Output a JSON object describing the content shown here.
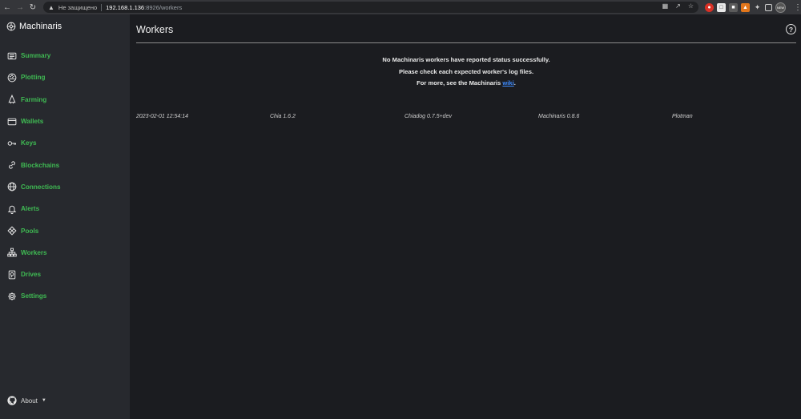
{
  "browser": {
    "security_label": "Не защищено",
    "url_host": "192.168.1.136",
    "url_rest": ":8926/workers",
    "profile_label": "NEW"
  },
  "sidebar": {
    "brand": "Machinaris",
    "items": [
      {
        "label": "Summary",
        "icon": "summary-icon"
      },
      {
        "label": "Plotting",
        "icon": "plotting-icon"
      },
      {
        "label": "Farming",
        "icon": "farming-icon"
      },
      {
        "label": "Wallets",
        "icon": "wallet-icon"
      },
      {
        "label": "Keys",
        "icon": "key-icon"
      },
      {
        "label": "Blockchains",
        "icon": "link-icon"
      },
      {
        "label": "Connections",
        "icon": "globe-icon"
      },
      {
        "label": "Alerts",
        "icon": "bell-icon"
      },
      {
        "label": "Pools",
        "icon": "pools-icon"
      },
      {
        "label": "Workers",
        "icon": "diagram-icon"
      },
      {
        "label": "Drives",
        "icon": "drive-icon"
      },
      {
        "label": "Settings",
        "icon": "gear-icon"
      }
    ],
    "about_label": "About"
  },
  "main": {
    "title": "Workers",
    "notice_line1": "No Machinaris workers have reported status successfully.",
    "notice_line2": "Please check each expected worker's log files.",
    "notice_line3_prefix": "For more, see the Machinaris ",
    "notice_link": "wiki",
    "notice_line3_suffix": ".",
    "status": {
      "timestamp": "2023-02-01 12:54:14",
      "chia_version": "Chia 1.6.2",
      "chiadog_version": "Chiadog 0.7.5+dev",
      "machinaris_version": "Machinaris 0.8.6",
      "plotman": "Plotman"
    }
  },
  "colors": {
    "accent_green": "#3fba53",
    "link_blue": "#3d8bff",
    "sidebar_bg": "#27292e",
    "main_bg": "#1b1c20"
  }
}
